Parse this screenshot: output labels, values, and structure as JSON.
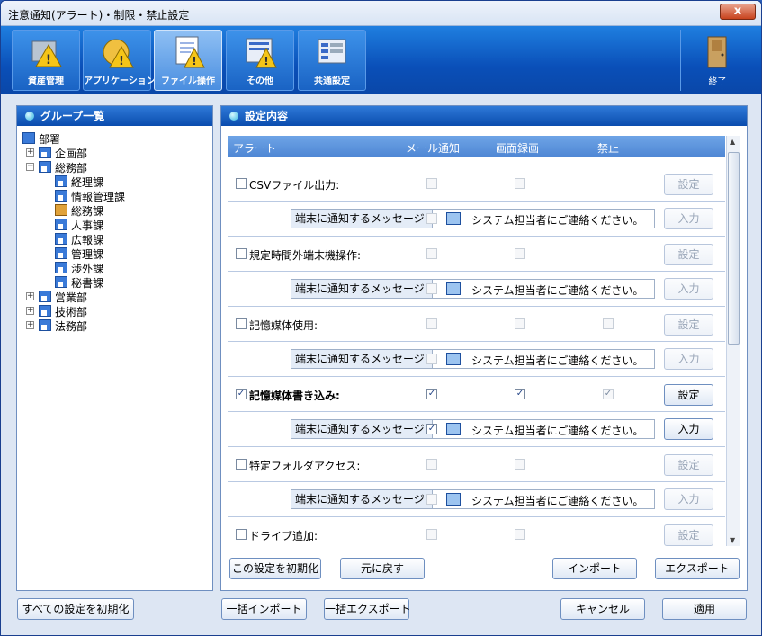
{
  "window": {
    "title": "注意通知(アラート)・制限・禁止設定",
    "close_label": "x"
  },
  "toolbar": {
    "tabs": [
      {
        "label": "資産管理",
        "icon": "asset-management-icon"
      },
      {
        "label": "アプリケーション",
        "icon": "application-icon"
      },
      {
        "label": "ファイル操作",
        "icon": "file-operation-icon",
        "active": true
      },
      {
        "label": "その他",
        "icon": "other-icon"
      },
      {
        "label": "共通設定",
        "icon": "common-settings-icon"
      }
    ],
    "exit_label": "終了"
  },
  "group_panel": {
    "title": "グループ一覧",
    "tree": [
      {
        "label": "部署"
      },
      {
        "label": "企画部"
      },
      {
        "label": "総務部"
      },
      {
        "label": "経理課"
      },
      {
        "label": "情報管理課"
      },
      {
        "label": "総務課"
      },
      {
        "label": "人事課"
      },
      {
        "label": "広報課"
      },
      {
        "label": "管理課"
      },
      {
        "label": "渉外課"
      },
      {
        "label": "秘書課"
      },
      {
        "label": "営業部"
      },
      {
        "label": "技術部"
      },
      {
        "label": "法務部"
      }
    ]
  },
  "settings_panel": {
    "title": "設定内容",
    "columns": {
      "alert": "アラート",
      "mail": "メール通知",
      "screen": "画面録画",
      "forbid": "禁止"
    },
    "message_label": "端末に通知するメッセージ:",
    "setting_button": "設定",
    "input_button": "入力",
    "rows": [
      {
        "label": "CSVファイル出力:",
        "checked": false,
        "mail": false,
        "screen": false,
        "forbid": null,
        "message": "システム担当者にご連絡ください。",
        "msg_checked": false
      },
      {
        "label": "規定時間外端末機操作:",
        "checked": false,
        "mail": false,
        "screen": false,
        "forbid": null,
        "message": "システム担当者にご連絡ください。",
        "msg_checked": false
      },
      {
        "label": "記憶媒体使用:",
        "checked": false,
        "mail": false,
        "screen": false,
        "forbid": false,
        "message": "システム担当者にご連絡ください。",
        "msg_checked": false
      },
      {
        "label": "記憶媒体書き込み:",
        "checked": true,
        "mail": true,
        "screen": true,
        "forbid": true,
        "message": "システム担当者にご連絡ください。",
        "msg_checked": true
      },
      {
        "label": "特定フォルダアクセス:",
        "checked": false,
        "mail": false,
        "screen": false,
        "forbid": null,
        "message": "システム担当者にご連絡ください。",
        "msg_checked": false
      },
      {
        "label": "ドライブ追加:",
        "checked": false,
        "mail": false,
        "screen": false,
        "forbid": null
      }
    ],
    "buttons": {
      "reset_setting": "この設定を初期化",
      "revert": "元に戻す",
      "import": "インポート",
      "export": "エクスポート"
    }
  },
  "footer": {
    "reset_all": "すべての設定を初期化",
    "bulk_import": "一括インポート",
    "bulk_export": "一括エクスポート",
    "cancel": "キャンセル",
    "apply": "適用"
  }
}
